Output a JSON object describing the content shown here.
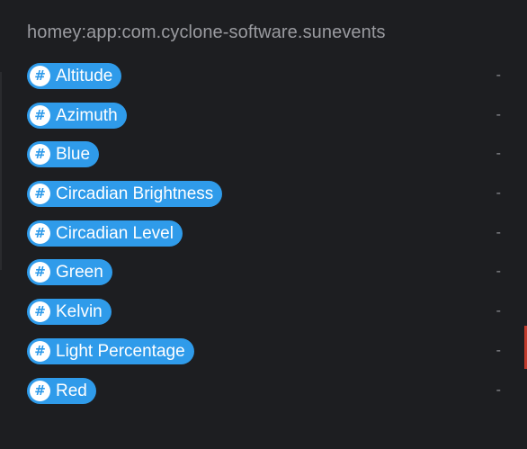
{
  "header": {
    "app_id": "homey:app:com.cyclone-software.sunevents"
  },
  "variables": [
    {
      "name": "Altitude",
      "value": "-",
      "icon": "hash-icon"
    },
    {
      "name": "Azimuth",
      "value": "-",
      "icon": "hash-icon"
    },
    {
      "name": "Blue",
      "value": "-",
      "icon": "hash-icon"
    },
    {
      "name": "Circadian Brightness",
      "value": "-",
      "icon": "hash-icon"
    },
    {
      "name": "Circadian Level",
      "value": "-",
      "icon": "hash-icon"
    },
    {
      "name": "Green",
      "value": "-",
      "icon": "hash-icon"
    },
    {
      "name": "Kelvin",
      "value": "-",
      "icon": "hash-icon"
    },
    {
      "name": "Light Percentage",
      "value": "-",
      "icon": "hash-icon"
    },
    {
      "name": "Red",
      "value": "-",
      "icon": "hash-icon"
    }
  ],
  "colors": {
    "background": "#1d1e21",
    "tag": "#2f9bea",
    "header_text": "#9a9ba0",
    "value_text": "#8d8e93"
  }
}
